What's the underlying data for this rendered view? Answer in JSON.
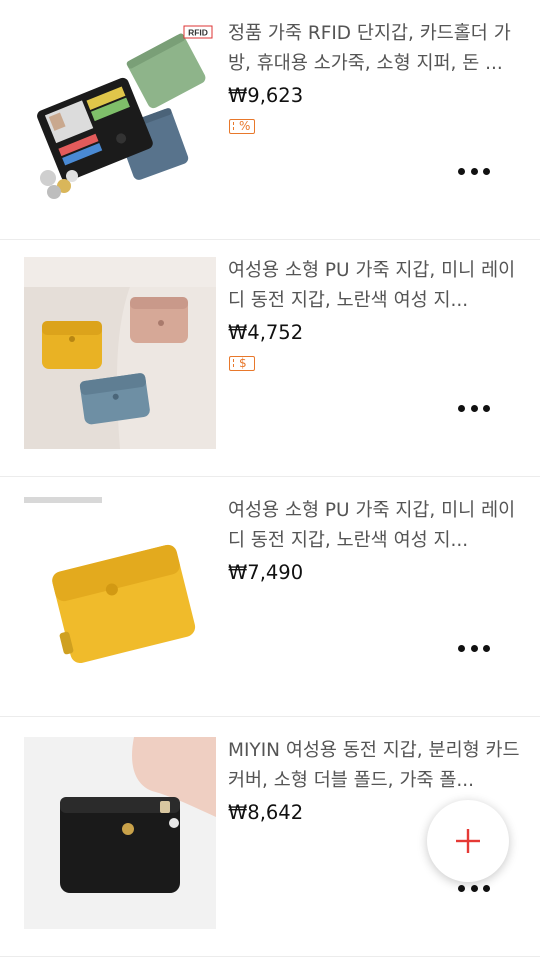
{
  "products": [
    {
      "title": "정품 가죽 RFID 단지갑, 카드홀더 가방, 휴대용 소가죽, 소형 지퍼, 돈 ...",
      "price": "₩9,623",
      "badge": "%",
      "image_label": "RFID"
    },
    {
      "title": "여성용 소형 PU 가죽 지갑, 미니 레이디 동전 지갑, 노란색 여성 지...",
      "price": "₩4,752",
      "badge": "$"
    },
    {
      "title": "여성용 소형 PU 가죽 지갑, 미니 레이디 동전 지갑, 노란색 여성 지...",
      "price": "₩7,490"
    },
    {
      "title": "MIYIN 여성용 동전 지갑, 분리형 카드 커버, 소형 더블 폴드, 가죽 폴...",
      "price": "₩8,642"
    }
  ],
  "fab": {
    "icon": "plus-icon",
    "color": "#e53935"
  },
  "colors": {
    "badge": "#e8782b",
    "price": "#111111",
    "title": "#555555"
  }
}
